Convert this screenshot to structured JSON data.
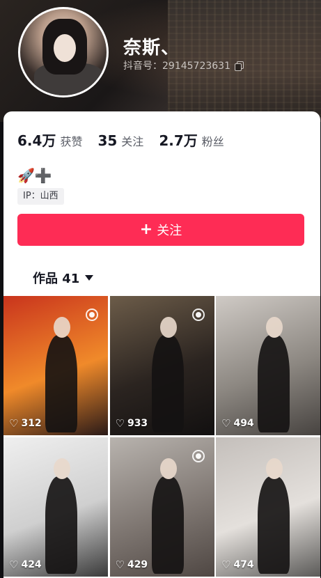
{
  "profile": {
    "name": "奈斯、",
    "douyin_id": "抖音号：29145723631"
  },
  "stats": [
    {
      "value": "6.4万",
      "label": "获赞"
    },
    {
      "value": "35",
      "label": "关注"
    },
    {
      "value": "2.7万",
      "label": "粉丝"
    }
  ],
  "badges": "🚀➕",
  "ip": "IP：山西",
  "follow_button": {
    "label": "关注"
  },
  "works_tab": {
    "label": "作品 41"
  },
  "grid": [
    {
      "likes": "312",
      "live": true,
      "colors": [
        "#c9341d",
        "#f08a2a",
        "#2a1a18"
      ]
    },
    {
      "likes": "933",
      "live": true,
      "colors": [
        "#6c5c49",
        "#2b2420",
        "#121010"
      ]
    },
    {
      "likes": "494",
      "live": false,
      "colors": [
        "#cfcac5",
        "#8c8781",
        "#474340"
      ]
    },
    {
      "likes": "424",
      "live": false,
      "colors": [
        "#efefef",
        "#cfcfcf",
        "#3a3a3a"
      ]
    },
    {
      "likes": "429",
      "live": true,
      "colors": [
        "#b8b3ae",
        "#7f7772",
        "#4f4743"
      ]
    },
    {
      "likes": "474",
      "live": false,
      "colors": [
        "#c4bfbb",
        "#e4e0dc",
        "#5b5a58"
      ]
    }
  ],
  "colors": {
    "accent": "#fe2c55",
    "text_primary": "#161823",
    "text_secondary": "#5a5d66"
  }
}
